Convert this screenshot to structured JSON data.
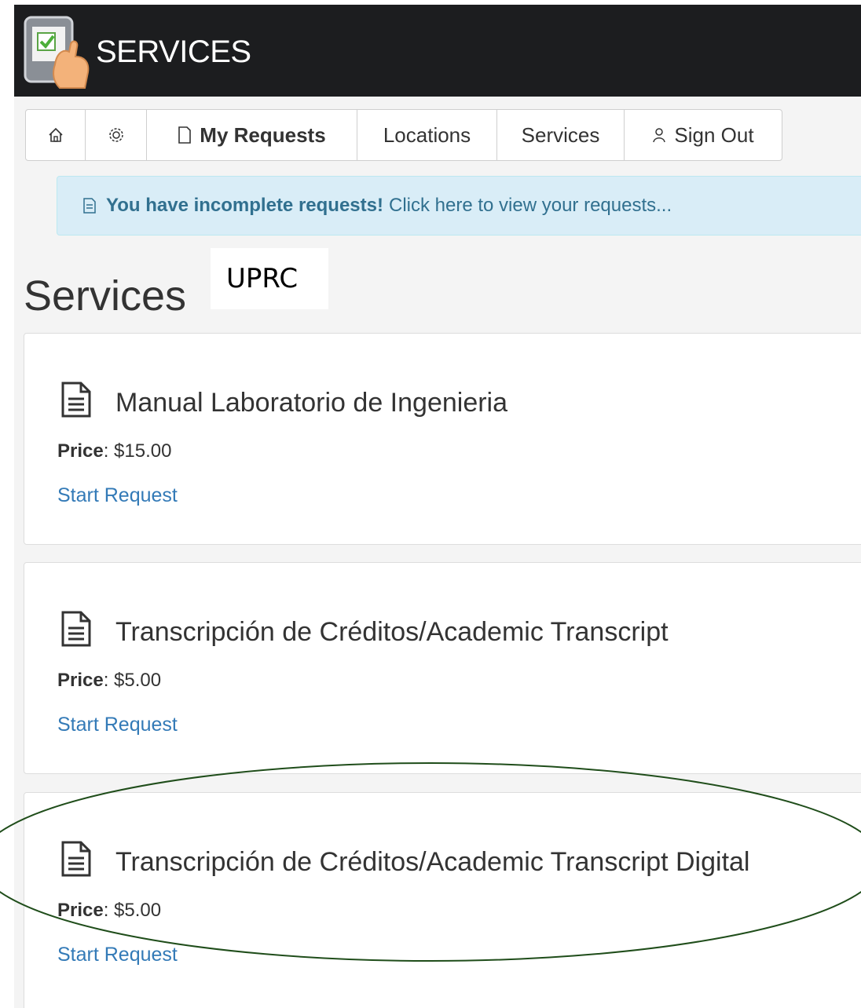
{
  "header": {
    "brand": "SERVICES"
  },
  "nav": {
    "tabs": [
      {
        "label": "",
        "icon": "home-icon"
      },
      {
        "label": "",
        "icon": "gear-icon"
      },
      {
        "label": "My Requests",
        "icon": "document-icon"
      },
      {
        "label": "Locations"
      },
      {
        "label": "Services"
      },
      {
        "label": "Sign Out",
        "icon": "user-icon"
      }
    ]
  },
  "alert": {
    "strong": "You have incomplete requests!",
    "text": "Click here to view your requests..."
  },
  "page": {
    "title": "Services",
    "overlay_label": "UPRC"
  },
  "services": [
    {
      "title": "Manual Laboratorio de Ingenieria",
      "price_label": "Price",
      "price": ": $15.00",
      "action": "Start Request"
    },
    {
      "title": "Transcripción de Créditos/Academic Transcript",
      "price_label": "Price",
      "price": ": $5.00",
      "action": "Start Request"
    },
    {
      "title": "Transcripción de Créditos/Academic Transcript Digital",
      "price_label": "Price",
      "price": ": $5.00",
      "action": "Start Request"
    }
  ],
  "colors": {
    "header_bg": "#1c1d1f",
    "alert_bg": "#d9edf7",
    "alert_text": "#31708f",
    "link": "#337ab7",
    "annotation_ellipse": "#1f4d1a"
  }
}
